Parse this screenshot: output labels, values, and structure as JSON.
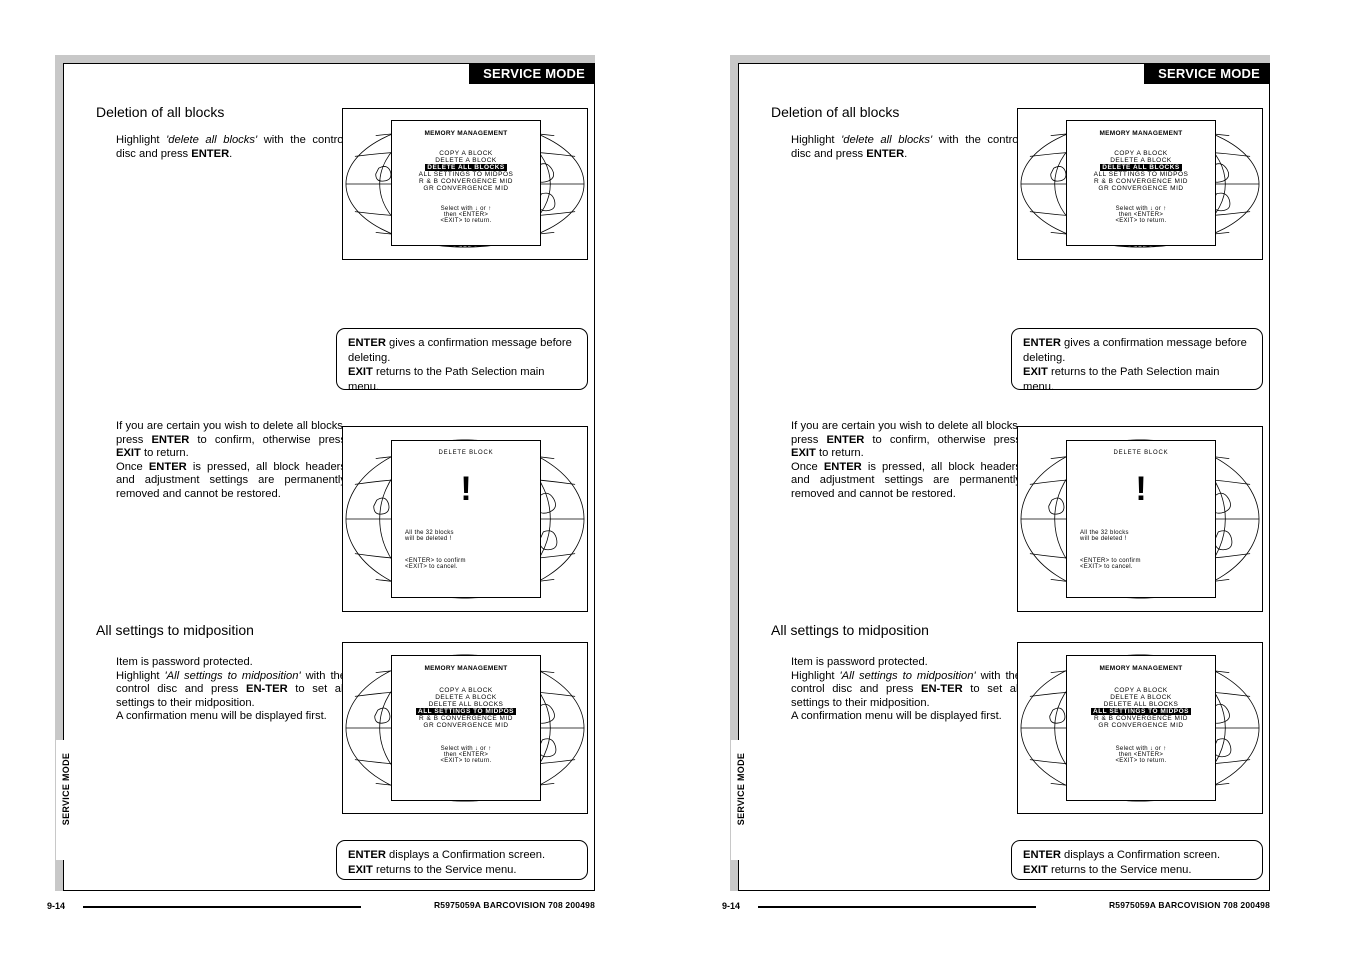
{
  "document": {
    "banner_title": "SERVICE MODE",
    "side_tab": "SERVICE MODE",
    "footer": {
      "page_number": "9-14",
      "reference": "R5975059A BARCOVISION 708 200498"
    }
  },
  "sections": {
    "deletion": {
      "heading": "Deletion of all blocks",
      "intro_html": "Highlight <i>'delete all blocks'</i> with the control disc and press <b>ENTER</b>.",
      "note_html": "<b>ENTER</b> gives a confirmation message before  deleting.<br><b>EXIT</b> returns to the Path Selection main menu.",
      "body_html": "If you are certain you wish to delete all blocks, press <b>ENTER</b> to confirm, otherwise press <b>EXIT</b> to return.<br>Once <b>ENTER</b> is pressed, all block headers and adjustment settings are permanently removed and cannot be restored."
    },
    "midposition": {
      "heading": "All settings to midposition",
      "body_html": "Item is password protected.<br>Highlight <i>'All settings to midposition'</i> with the control disc and press <b>EN-TER</b> to set all settings to their midposition.<br>A confirmation menu will be displayed first.",
      "note_html": "<b>ENTER</b> displays a Confirmation screen.<br><b>EXIT</b> returns to the Service menu."
    }
  },
  "osd_screens": {
    "memory_management_delete": {
      "title": "MEMORY MANAGEMENT",
      "items": [
        "COPY  A  BLOCK",
        "DELETE  A  BLOCK",
        "DELETE  ALL  BLOCKS",
        "ALL  SETTINGS  TO  MIDPOS",
        "R & B  CONVERGENCE  MID",
        "GR  CONVERGENCE  MID"
      ],
      "highlighted_index": 2,
      "footer_lines": [
        "Select with   ↓ or ↑",
        "then  <ENTER>",
        "<EXIT>  to  return."
      ]
    },
    "delete_block": {
      "title": "DELETE  BLOCK",
      "glyph": "!",
      "lines": [
        "All the  32  blocks",
        "will be  deleted  !"
      ],
      "footer_lines": [
        "<ENTER>  to  confirm",
        "<EXIT>  to  cancel."
      ]
    },
    "memory_management_midpos": {
      "title": "MEMORY MANAGEMENT",
      "items": [
        "COPY  A  BLOCK",
        "DELETE  A  BLOCK",
        "DELETE  ALL  BLOCKS",
        "ALL  SETTINGS  TO  MIDPOS",
        "R & B  CONVERGENCE  MID",
        "GR  CONVERGENCE  MID"
      ],
      "highlighted_index": 3,
      "footer_lines": [
        "Select with   ↓ or ↑",
        "then  <ENTER>",
        "<EXIT>  to  return."
      ]
    }
  }
}
